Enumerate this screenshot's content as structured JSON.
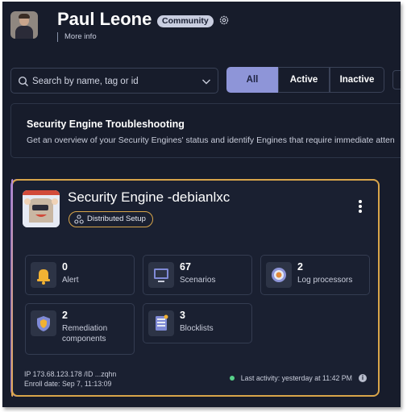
{
  "user": {
    "name": "Paul Leone",
    "tier_badge": "Community",
    "more_info": "More info"
  },
  "search": {
    "placeholder": "Search by name, tag or id"
  },
  "filters": {
    "all": "All",
    "active": "Active",
    "inactive": "Inactive",
    "selected": "All"
  },
  "banner": {
    "title": "Security Engine Troubleshooting",
    "description": "Get an overview of your Security Engines' status and identify Engines that require immediate atten"
  },
  "engine": {
    "name": "Security Engine -debianlxc",
    "setup_badge": "Distributed Setup",
    "stats": [
      {
        "value": "0",
        "label": "Alert",
        "icon": "bell-icon"
      },
      {
        "value": "67",
        "label": "Scenarios",
        "icon": "monitor-icon"
      },
      {
        "value": "2",
        "label": "Log processors",
        "icon": "target-icon"
      },
      {
        "value": "2",
        "label": "Remediation components",
        "icon": "shield-icon"
      },
      {
        "value": "3",
        "label": "Blocklists",
        "icon": "document-list-icon"
      }
    ],
    "ip_line": "IP 173.68.123.178 /ID ...zqhn",
    "enroll_line": "Enroll date: Sep 7, 11:13:09",
    "last_activity": "Last activity: yesterday at 11:42 PM"
  },
  "colors": {
    "background": "#171c2b",
    "accent_filter": "#8e95d8",
    "card_border": "#d8a54a",
    "status_online": "#57d18a"
  }
}
